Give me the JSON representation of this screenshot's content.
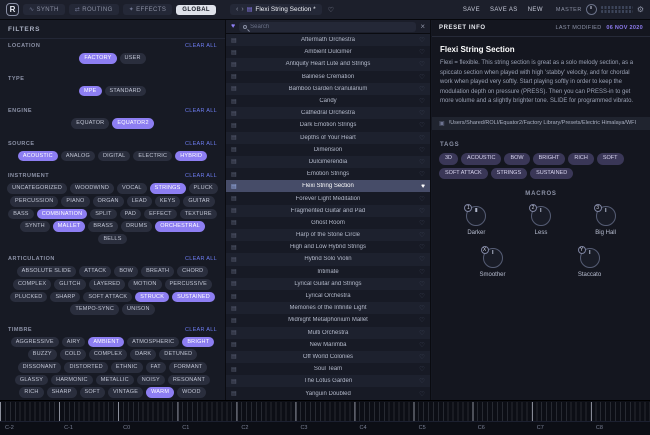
{
  "icons": {
    "logo": "R",
    "synth": "∿",
    "routing": "⇄",
    "effects": "✦",
    "prev": "‹",
    "next": "›",
    "doc": "▤",
    "heart_outline": "♡",
    "heart_filled": "♥",
    "gear": "⚙",
    "clear_x": "×",
    "file": "▤",
    "folder": "▣"
  },
  "topbar": {
    "logo": "R",
    "tabs": [
      {
        "label": "SYNTH"
      },
      {
        "label": "ROUTING"
      },
      {
        "label": "EFFECTS"
      },
      {
        "label": "GLOBAL"
      }
    ],
    "active_tab": "GLOBAL",
    "preset_title": "Flexi String Section *",
    "save_label": "SAVE",
    "save_as_label": "SAVE AS",
    "new_label": "NEW",
    "master_label": "MASTER"
  },
  "filters": {
    "title": "FILTERS",
    "clear_all": "CLEAR ALL",
    "sections": [
      {
        "label": "LOCATION",
        "clear": true,
        "chips": [
          {
            "label": "FACTORY",
            "selected": true
          },
          {
            "label": "USER",
            "selected": false
          }
        ]
      },
      {
        "label": "TYPE",
        "clear": false,
        "chips": [
          {
            "label": "MPE",
            "selected": true
          },
          {
            "label": "STANDARD",
            "selected": false
          }
        ]
      },
      {
        "label": "ENGINE",
        "clear": true,
        "chips": [
          {
            "label": "EQUATOR",
            "selected": false
          },
          {
            "label": "EQUATOR2",
            "selected": true
          }
        ]
      },
      {
        "label": "SOURCE",
        "clear": true,
        "chips": [
          {
            "label": "ACOUSTIC",
            "selected": true
          },
          {
            "label": "ANALOG",
            "selected": false
          },
          {
            "label": "DIGITAL",
            "selected": false
          },
          {
            "label": "ELECTRIC",
            "selected": false
          },
          {
            "label": "HYBRID",
            "selected": true
          }
        ]
      },
      {
        "label": "INSTRUMENT",
        "clear": true,
        "chips": [
          {
            "label": "UNCATEGORIZED",
            "selected": false
          },
          {
            "label": "WOODWIND",
            "selected": false
          },
          {
            "label": "VOCAL",
            "selected": false
          },
          {
            "label": "STRINGS",
            "selected": true
          },
          {
            "label": "PLUCK",
            "selected": false
          },
          {
            "label": "PERCUSSION",
            "selected": false
          },
          {
            "label": "PIANO",
            "selected": false
          },
          {
            "label": "ORGAN",
            "selected": false
          },
          {
            "label": "LEAD",
            "selected": false
          },
          {
            "label": "KEYS",
            "selected": false
          },
          {
            "label": "GUITAR",
            "selected": false
          },
          {
            "label": "BASS",
            "selected": false
          },
          {
            "label": "COMBINATION",
            "selected": true
          },
          {
            "label": "SPLIT",
            "selected": false
          },
          {
            "label": "PAD",
            "selected": false
          },
          {
            "label": "EFFECT",
            "selected": false
          },
          {
            "label": "TEXTURE",
            "selected": false
          },
          {
            "label": "SYNTH",
            "selected": false
          },
          {
            "label": "MALLET",
            "selected": true
          },
          {
            "label": "BRASS",
            "selected": false
          },
          {
            "label": "DRUMS",
            "selected": false
          },
          {
            "label": "ORCHESTRAL",
            "selected": true
          },
          {
            "label": "BELLS",
            "selected": false
          }
        ]
      },
      {
        "label": "ARTICULATION",
        "clear": true,
        "chips": [
          {
            "label": "ABSOLUTE SLIDE",
            "selected": false
          },
          {
            "label": "ATTACK",
            "selected": false
          },
          {
            "label": "BOW",
            "selected": false
          },
          {
            "label": "BREATH",
            "selected": false
          },
          {
            "label": "CHORD",
            "selected": false
          },
          {
            "label": "COMPLEX",
            "selected": false
          },
          {
            "label": "GLITCH",
            "selected": false
          },
          {
            "label": "LAYERED",
            "selected": false
          },
          {
            "label": "MOTION",
            "selected": false
          },
          {
            "label": "PERCUSSIVE",
            "selected": false
          },
          {
            "label": "PLUCKED",
            "selected": false
          },
          {
            "label": "SHARP",
            "selected": false
          },
          {
            "label": "SOFT ATTACK",
            "selected": false
          },
          {
            "label": "STRUCK",
            "selected": true
          },
          {
            "label": "SUSTAINED",
            "selected": true
          },
          {
            "label": "TEMPO-SYNC",
            "selected": false
          },
          {
            "label": "UNISON",
            "selected": false
          }
        ]
      },
      {
        "label": "TIMBRE",
        "clear": true,
        "chips": [
          {
            "label": "AGGRESSIVE",
            "selected": false
          },
          {
            "label": "AIRY",
            "selected": false
          },
          {
            "label": "AMBIENT",
            "selected": true
          },
          {
            "label": "ATMOSPHERIC",
            "selected": false
          },
          {
            "label": "BRIGHT",
            "selected": true
          },
          {
            "label": "BUZZY",
            "selected": false
          },
          {
            "label": "COLD",
            "selected": false
          },
          {
            "label": "COMPLEX",
            "selected": false
          },
          {
            "label": "DARK",
            "selected": false
          },
          {
            "label": "DETUNED",
            "selected": false
          },
          {
            "label": "DISSONANT",
            "selected": false
          },
          {
            "label": "DISTORTED",
            "selected": false
          },
          {
            "label": "ETHNIC",
            "selected": false
          },
          {
            "label": "FAT",
            "selected": false
          },
          {
            "label": "FORMANT",
            "selected": false
          },
          {
            "label": "GLASSY",
            "selected": false
          },
          {
            "label": "HARMONIC",
            "selected": false
          },
          {
            "label": "METALLIC",
            "selected": false
          },
          {
            "label": "NOISY",
            "selected": false
          },
          {
            "label": "RESONANT",
            "selected": false
          },
          {
            "label": "RICH",
            "selected": false
          },
          {
            "label": "SHARP",
            "selected": false
          },
          {
            "label": "SOFT",
            "selected": false
          },
          {
            "label": "VINTAGE",
            "selected": false
          },
          {
            "label": "WARM",
            "selected": true
          },
          {
            "label": "WOOD",
            "selected": false
          }
        ]
      }
    ]
  },
  "preset_list": {
    "search_placeholder": "Search",
    "selected": "Flexi String Section",
    "items": [
      "Aftermath Orchestra",
      "Ambient Dulcimer",
      "Antiquity Heart Lute and Strings",
      "Balinese Cremation",
      "Bamboo Garden Granularium",
      "Candy",
      "Cathedral Orchestra",
      "Dark Emotion Strings",
      "Depths of Your Heart",
      "Dimension",
      "Dulcimerendia",
      "Emotion Strings",
      "Flexi String Section",
      "Forever Light Meditation",
      "Fragmented Guitar and Pad",
      "Ghost Room",
      "Harp of the Stone Circle",
      "High and Low Hybrid Strings",
      "Hybrid Solo Violin",
      "Intimate",
      "Lyrical Guitar and Strings",
      "Lyrical Orchestra",
      "Memories of the Infinite Light",
      "Midnight Metalphonium Mallet",
      "Multi Orchestra",
      "New Marimba",
      "Off World Colonies",
      "Soul Team",
      "The Lotus Garden",
      "Yanguin Doubled"
    ]
  },
  "info": {
    "header": "PRESET INFO",
    "last_modified_label": "LAST MODIFIED",
    "last_modified_value": "06 NOV 2020",
    "title": "Flexi String Section",
    "description": "Flexi = flexible. This string section is great as a solo melody section, as a spiccato section when played with high 'stabby' velocity, and for chordal work when played very softly. Start playing softly in order to keep the modulation depth on pressure (PRESS). Then you can PRESS-in to get more volume and a slightly brighter tone. SLIDE for programmed vibrato.",
    "path": "/Users/Shared/ROLI/Equator2/Factory Library/Presets/Electric Himalaya/WFI",
    "tags_label": "TAGS",
    "tags": [
      "3D",
      "ACOUSTIC",
      "BOW",
      "BRIGHT",
      "RICH",
      "SOFT",
      "SOFT ATTACK",
      "STRINGS",
      "SUSTAINED"
    ],
    "macros_label": "MACROS",
    "macros": [
      {
        "key": "1",
        "label": "Darker"
      },
      {
        "key": "2",
        "label": "Less"
      },
      {
        "key": "3",
        "label": "Big Hall"
      },
      {
        "key": "X",
        "label": "Smoother"
      },
      {
        "key": "Y",
        "label": "Staccato"
      }
    ]
  },
  "keyboard": {
    "octaves": [
      "C-2",
      "C-1",
      "C0",
      "C1",
      "C2",
      "C3",
      "C4",
      "C5",
      "C6",
      "C7",
      "C8"
    ]
  }
}
